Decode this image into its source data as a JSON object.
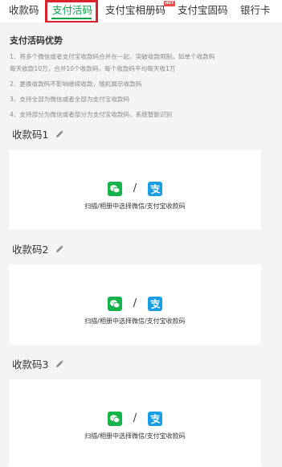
{
  "tabs": [
    {
      "label": "收款码",
      "active": false
    },
    {
      "label": "支付活码",
      "active": true
    },
    {
      "label": "支付宝相册码",
      "active": false,
      "badge": "HOT"
    },
    {
      "label": "支付宝固码",
      "active": false
    },
    {
      "label": "银行卡",
      "active": false
    }
  ],
  "advantages": {
    "title": "支付活码优势",
    "lines": [
      "1、将多个微信或者支付宝收款码合并在一起，突破收款限制，如单个收款码",
      "每天收款10万，合并10个收款码，每个收款码平均每天收1万",
      "2、更换收款码不影响继续收款，随机展示收款码",
      "3、支持全部为微信或者全部为支付宝收款码",
      "4、支持部分为微信或者部分为支付宝收款码，系统智能识别"
    ]
  },
  "codes": [
    {
      "title": "收款码1",
      "slash": "/",
      "hint": "扫描/相册中选择微信/支付宝收款码"
    },
    {
      "title": "收款码2",
      "slash": "/",
      "hint": "扫描/相册中选择微信/支付宝收款码"
    },
    {
      "title": "收款码3",
      "slash": "/",
      "hint": "扫描/相册中选择微信/支付宝收款码"
    }
  ],
  "colors": {
    "accent": "#0aa34a",
    "highlight_box": "#d9232c",
    "wechat": "#16b34a",
    "alipay": "#1a9ee3"
  },
  "icons": {
    "edit": "pencil-icon",
    "wechat": "wechat-icon",
    "alipay": "alipay-icon"
  }
}
